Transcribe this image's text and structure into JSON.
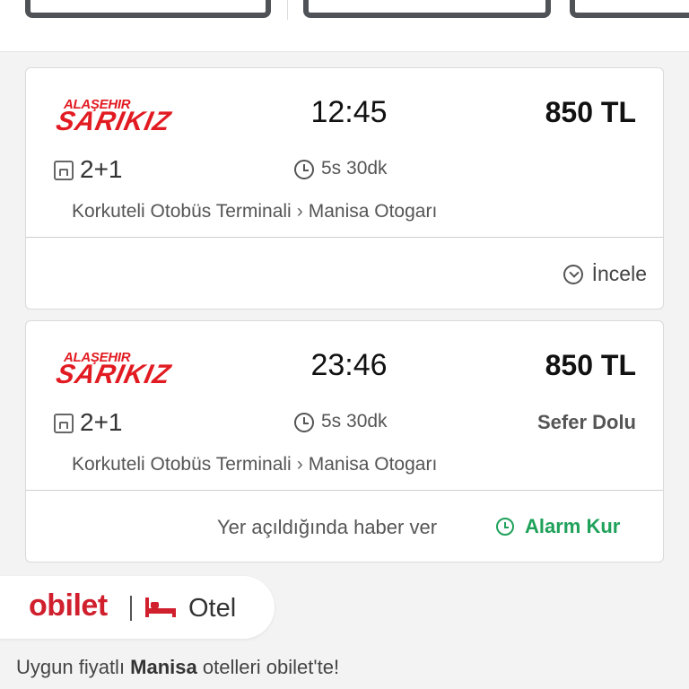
{
  "colors": {
    "brand_red": "#e21b22",
    "obilet_red": "#d0202e",
    "alarm_green": "#1fa15a"
  },
  "trips": [
    {
      "operator_logo_small": "ALAŞEHIR",
      "operator_logo_big": "SARIKIZ",
      "departure_time": "12:45",
      "price": "850 TL",
      "seat_layout": "2+1",
      "duration": "5s 30dk",
      "status": "",
      "origin": "Korkuteli Otobüs Terminali",
      "destination": "Manisa Otogarı",
      "action_label": "İncele"
    },
    {
      "operator_logo_small": "ALAŞEHIR",
      "operator_logo_big": "SARIKIZ",
      "departure_time": "23:46",
      "price": "850 TL",
      "seat_layout": "2+1",
      "duration": "5s 30dk",
      "status": "Sefer Dolu",
      "origin": "Korkuteli Otobüs Terminali",
      "destination": "Manisa Otogarı",
      "notify_text": "Yer açıldığında haber ver",
      "alarm_label": "Alarm Kur"
    }
  ],
  "hotel_banner": {
    "brand": "obilet",
    "label": "Otel",
    "promo_prefix": "Uygun fiyatlı ",
    "promo_city": "Manisa",
    "promo_suffix": " otelleri obilet'te!"
  },
  "icons": [
    "seat-layout-icon",
    "clock-icon",
    "chevron-down-circle-icon",
    "alarm-clock-icon",
    "bed-icon"
  ]
}
